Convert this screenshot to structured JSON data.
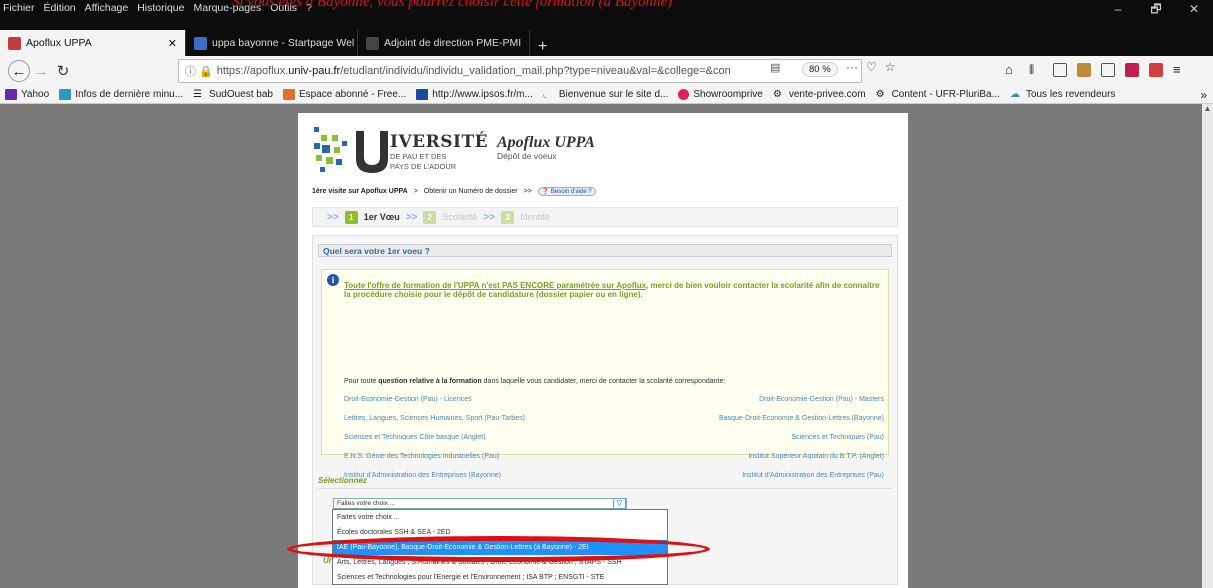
{
  "annotation_text": "Si vous êtes à Bayonne, vous pourrez choisir cette formation (à Bayonne)",
  "menu": [
    "Fichier",
    "Édition",
    "Affichage",
    "Historique",
    "Marque-pages",
    "Outils",
    "?"
  ],
  "window_controls": [
    "–",
    "🗗",
    "✕"
  ],
  "tabs": [
    {
      "title": "Apoflux UPPA",
      "close": "✕"
    },
    {
      "title": "uppa bayonne - Startpage Wel",
      "close": "✕"
    },
    {
      "title": "Adjoint de direction PME-PMI",
      "close": "✕"
    }
  ],
  "new_tab": "+",
  "url": {
    "prefix": "https://apoflux.",
    "domain": "univ-pau.fr",
    "path": "/etudiant/individu/individu_validation_mail.php?type=niveau&val=&college=&con"
  },
  "zoom": "80 %",
  "bookmarks": [
    "Yahoo",
    "Infos de dernière minu...",
    "SudOuest bab",
    "Espace abonné - Free...",
    "http://www.ipsos.fr/m...",
    "Bienvenue sur le site d...",
    "Showroomprive",
    "vente-privee.com",
    "Content - UFR-PluriBa...",
    "Tous les revendeurs"
  ],
  "bookmarks_more": "»",
  "logo": {
    "uni": "IVERSITÉ",
    "sub1": "DE PAU ET DES",
    "sub2": "PAYS DE L'ADOUR"
  },
  "app": {
    "title": "Apoflux UPPA",
    "subtitle": "Dépôt de voeux"
  },
  "breadcrumb": {
    "first": "1ère visite sur Apoflux UPPA",
    "sep1": ">",
    "second": "Obtenir un Numéro de dossier",
    "sep2": ">>",
    "help": "Besoin d'aide ?"
  },
  "steps": [
    {
      "num": "1",
      "label": "1er Vœu",
      "color": "#8cbf2c"
    },
    {
      "num": "2",
      "label": "Scolarité",
      "color": "#c9dea0"
    },
    {
      "num": "3",
      "label": "Identité",
      "color": "#c9dea0"
    }
  ],
  "question": "Quel sera votre 1er voeu ?",
  "notice": {
    "underlined": "Toute l'offre de formation de l'UPPA n'est PAS ENCORE paramétrée sur Apoflux",
    "rest": ", merci de bien vouloir contacter la scolarité afin de connaitre la procédure choisie pour le dépôt de candidature (dossier papier ou en ligne)."
  },
  "contact": {
    "pre": "Pour toute ",
    "bold": "question relative à la formation",
    "post": " dans laquelle vous candidater, merci de contacter la scolarité correspondante:"
  },
  "links": [
    {
      "left": "Droit-Economie-Gestion (Pau) - Licences",
      "right": "Droit-Economie-Gestion (Pau) - Masters"
    },
    {
      "left": "Lettres, Langues, Sciences Humaines, Sport (Pau-Tarbes)",
      "right": "Basque-Droit-Economie & Gestion-Lettres (Bayonne)"
    },
    {
      "left": "Sciences et Techniques Côte basque (Anglet)",
      "right": "Sciences et Techniques (Pau)"
    },
    {
      "left": "E.N.S. Génie des Technologies Industrielles (Pau)",
      "right": "Institut Supérieur Aquitain du B.T.P. (Anglet)"
    },
    {
      "left": "Institut d'Administration des Entreprises (Bayonne)",
      "right": "Institut d'Administration des Entreprises (Pau)"
    }
  ],
  "select": {
    "label": "Sélectionnez",
    "value": "Faites votre choix ...",
    "arrow": "▽",
    "options": [
      "Faites votre choix ...",
      "Écoles doctorales SSH & SEA - 2ED",
      "IAE (Pau-Bayonne), Basque-Droit-Economie & Gestion-Lettres (à Bayonne) - 2EI",
      "Arts, Lettres, Langues ; S.Humaines & Sociales ; Droit, Economie & Gestion ; STAPS - SSH",
      "Sciences et Technologies pour l'Energie et l'Environnement ; ISA BTP ; ENSGTI - STE"
    ],
    "selected_index": 2
  },
  "behind_text": "Ur",
  "colors": {
    "accent_green": "#8cbf2c",
    "link_blue": "#4a8ab8",
    "highlight": "#1e90ff",
    "annotation_red": "#e01010"
  }
}
